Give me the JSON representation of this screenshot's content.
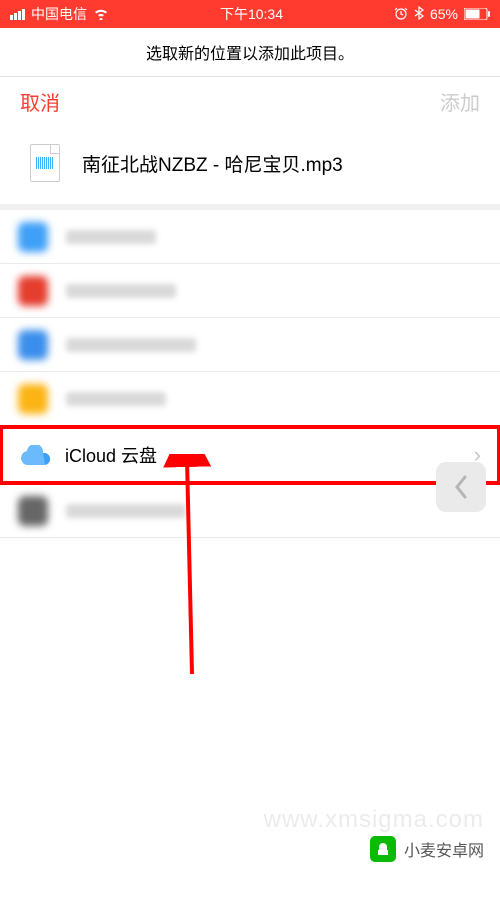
{
  "status_bar": {
    "carrier": "中国电信",
    "time": "下午10:34",
    "battery": "65%"
  },
  "header": {
    "instruction": "选取新的位置以添加此项目。",
    "cancel": "取消",
    "add": "添加"
  },
  "file": {
    "name": "南征北战NZBZ - 哈尼宝贝.mp3"
  },
  "locations": {
    "icloud": "iCloud 云盘"
  },
  "watermark": {
    "site": "小麦安卓网",
    "url": "www.xmsigma.com"
  }
}
